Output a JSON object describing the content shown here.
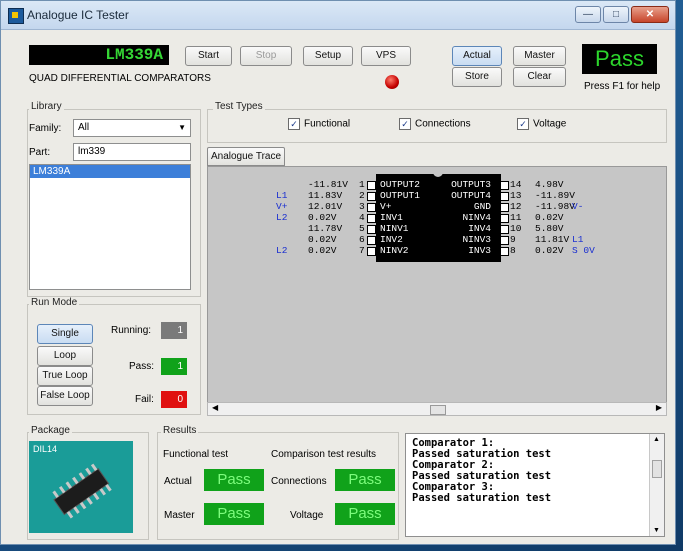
{
  "window": {
    "title": "Analogue IC Tester",
    "minimize": "—",
    "maximize": "□",
    "close": "✕"
  },
  "toolbar": {
    "device_lcd": "LM339A",
    "device_desc": "QUAD DIFFERENTIAL COMPARATORS",
    "start": "Start",
    "stop": "Stop",
    "setup": "Setup",
    "vps": "VPS",
    "actual": "Actual",
    "master": "Master",
    "store": "Store",
    "clear": "Clear",
    "pass_lcd": "Pass",
    "help": "Press F1 for help"
  },
  "library": {
    "label": "Library",
    "family_label": "Family:",
    "family_value": "All",
    "part_label": "Part:",
    "part_value": "lm339",
    "list": [
      "LM339A"
    ]
  },
  "test_types": {
    "label": "Test Types",
    "functional": "Functional",
    "connections": "Connections",
    "voltage": "Voltage"
  },
  "tab": {
    "analogue_trace": "Analogue Trace"
  },
  "trace": {
    "left": [
      {
        "tag": "",
        "v": "-11.81V",
        "n": "1",
        "name": "OUTPUT2"
      },
      {
        "tag": "L1",
        "v": "11.83V",
        "n": "2",
        "name": "OUTPUT1"
      },
      {
        "tag": "V+",
        "v": "12.01V",
        "n": "3",
        "name": "V+"
      },
      {
        "tag": "L2",
        "v": "0.02V",
        "n": "4",
        "name": "INV1"
      },
      {
        "tag": "",
        "v": "11.78V",
        "n": "5",
        "name": "NINV1"
      },
      {
        "tag": "",
        "v": "0.02V",
        "n": "6",
        "name": "INV2"
      },
      {
        "tag": "L2",
        "v": "0.02V",
        "n": "7",
        "name": "NINV2"
      }
    ],
    "right": [
      {
        "name": "OUTPUT3",
        "n": "14",
        "v": "4.98V",
        "tag": ""
      },
      {
        "name": "OUTPUT4",
        "n": "13",
        "v": "-11.89V",
        "tag": ""
      },
      {
        "name": "GND",
        "n": "12",
        "v": "-11.98V",
        "tag": "V-"
      },
      {
        "name": "NINV4",
        "n": "11",
        "v": "0.02V",
        "tag": ""
      },
      {
        "name": "INV4",
        "n": "10",
        "v": "5.80V",
        "tag": ""
      },
      {
        "name": "NINV3",
        "n": "9",
        "v": "11.81V",
        "tag": "L1"
      },
      {
        "name": "INV3",
        "n": "8",
        "v": "0.02V",
        "tag": "S 0V"
      }
    ]
  },
  "run_mode": {
    "label": "Run Mode",
    "single": "Single",
    "loop": "Loop",
    "true_loop": "True Loop",
    "false_loop": "False Loop",
    "running_label": "Running:",
    "running_value": "1",
    "pass_label": "Pass:",
    "pass_value": "1",
    "fail_label": "Fail:",
    "fail_value": "0"
  },
  "package": {
    "label": "Package",
    "name": "DIL14"
  },
  "results": {
    "label": "Results",
    "functional_header": "Functional test",
    "comparison_header": "Comparison test results",
    "actual_label": "Actual",
    "actual_value": "Pass",
    "master_label": "Master",
    "master_value": "Pass",
    "connections_label": "Connections",
    "connections_value": "Pass",
    "voltage_label": "Voltage",
    "voltage_value": "Pass",
    "log": [
      "Comparator 1:",
      "Passed saturation test",
      "Comparator 2:",
      "Passed saturation test",
      "Comparator 3:",
      "Passed saturation test"
    ]
  },
  "colors": {
    "pass_green": "#10a21a",
    "fail_red": "#e01010",
    "running_gray": "#7a7a7a",
    "tag_blue": "#1a2fd0"
  }
}
